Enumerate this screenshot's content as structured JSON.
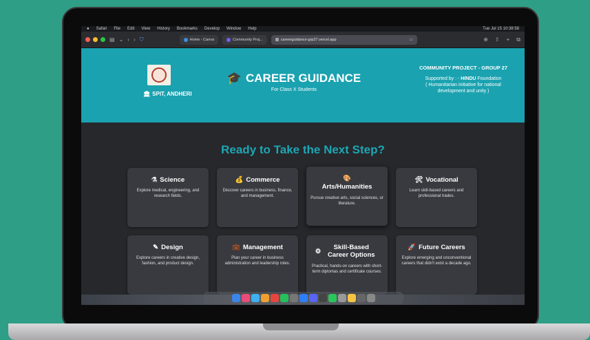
{
  "menubar": {
    "items": [
      "Safari",
      "File",
      "Edit",
      "View",
      "History",
      "Bookmarks",
      "Develop",
      "Window",
      "Help"
    ],
    "right": [
      "Tue Jul 15 10:38:58"
    ]
  },
  "browser": {
    "tabs": [
      {
        "label": "Home - Canva"
      },
      {
        "label": "Community Proj..."
      }
    ],
    "url": "careerguidance-grp27.vercel.app"
  },
  "header": {
    "institute": "SPIT, ANDHERI",
    "title": "CAREER GUIDANCE",
    "subtitle": "For Class X Students",
    "community_title": "COMMUNITY PROJECT - GROUP 27",
    "supported_prefix": "Supported by : -",
    "supporter": "HINDU",
    "supporter_suffix": "Foundation",
    "supporter_note": "( Humanitarian initiative for national development and unity )"
  },
  "main": {
    "headline": "Ready to Take the Next Step?",
    "cards": [
      {
        "title": "Science",
        "desc": "Explore medical, engineering, and research fields.",
        "icon": "microscope-icon",
        "glyph": "⚗"
      },
      {
        "title": "Commerce",
        "desc": "Discover careers in business, finance, and management.",
        "icon": "money-icon",
        "glyph": "💰"
      },
      {
        "title": "Arts/Humanities",
        "desc": "Pursue creative arts, social sciences, or literature.",
        "icon": "palette-icon",
        "glyph": "🎨"
      },
      {
        "title": "Vocational",
        "desc": "Learn skill-based careers and professional trades.",
        "icon": "tools-icon",
        "glyph": "🛠"
      },
      {
        "title": "Design",
        "desc": "Explore careers in creative design, fashion, and product design.",
        "icon": "design-icon",
        "glyph": "✎"
      },
      {
        "title": "Management",
        "desc": "Plan your career in business administration and leadership roles.",
        "icon": "briefcase-icon",
        "glyph": "💼"
      },
      {
        "title": "Skill-Based Career Options",
        "desc": "Practical, hands-on careers with short-term diplomas and certificate courses.",
        "icon": "gears-icon",
        "glyph": "⚙"
      },
      {
        "title": "Future Careers",
        "desc": "Explore emerging and unconventional careers that didn't exist a decade ago.",
        "icon": "rocket-icon",
        "glyph": "🚀"
      }
    ]
  },
  "dock": {
    "colors": [
      "#3a86e8",
      "#e94c7a",
      "#3fb0f0",
      "#f0a030",
      "#e8453c",
      "#26c05a",
      "#777",
      "#2d7ff9",
      "#5865f2",
      "#444",
      "#2ac659",
      "#999",
      "#f5c542",
      "#666",
      "#888"
    ]
  }
}
